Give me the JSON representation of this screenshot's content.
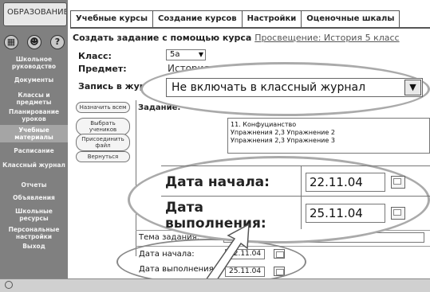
{
  "sidebar": {
    "logo_text": "ОБРАЗОВАНИЕ",
    "toolbar_icons": [
      {
        "icon": "grid-icon",
        "glyph": "▦"
      },
      {
        "icon": "people-icon",
        "glyph": "☻"
      },
      {
        "icon": "help-icon",
        "glyph": "?"
      }
    ],
    "items": [
      "Школьное руководство",
      "Документы",
      "Классы и предметы",
      "Планирование уроков",
      "Учебные материалы",
      "Расписание",
      "Классный журнал",
      "Отчеты",
      "Объявления",
      "Школьные ресурсы",
      "Персональные настройки",
      "Выход"
    ]
  },
  "tabs": [
    "Учебные курсы",
    "Создание курсов",
    "Настройки",
    "Оценочные шкалы"
  ],
  "main": {
    "heading_prefix": "Создать задание с помощью курса ",
    "heading_link": "Просвещение: История 5 класс",
    "class_label": "Класс:",
    "class_value": "5а",
    "subject_label": "Предмет:",
    "subject_value": "История",
    "journal_label": "Запись в журнал:",
    "journal_value": "Не включать в классный журнал",
    "buttons": [
      "Назначить всем",
      "Выбрать учеников",
      "Присоединить файл",
      "Вернуться"
    ],
    "task_label": "Задание:",
    "task_lines": [
      "11. Конфуцианство",
      "Упражнения 2,3 Упражнение 2",
      "Упражнения 2,3 Упражнение 3"
    ],
    "topic_label": "Тема задания:",
    "start_label": "Дата начала:",
    "start_value": "22.11.04",
    "due_label": "Дата выполнения:",
    "due_value": "25.11.04"
  }
}
